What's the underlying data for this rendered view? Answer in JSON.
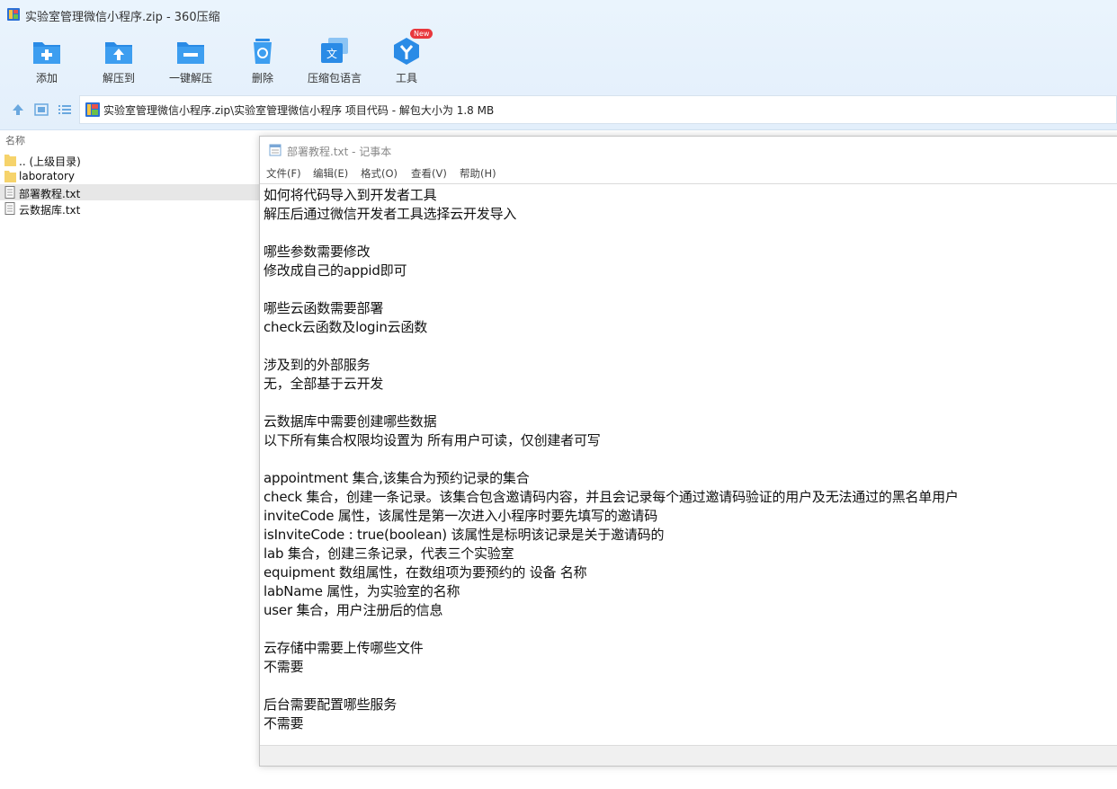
{
  "window": {
    "title": "实验室管理微信小程序.zip - 360压缩"
  },
  "toolbar": {
    "items": [
      {
        "label": "添加",
        "icon": "add-icon"
      },
      {
        "label": "解压到",
        "icon": "extract-to-icon"
      },
      {
        "label": "一键解压",
        "icon": "one-click-extract-icon"
      },
      {
        "label": "删除",
        "icon": "delete-icon"
      },
      {
        "label": "压缩包语言",
        "icon": "language-icon"
      },
      {
        "label": "工具",
        "icon": "tools-icon",
        "badge": "New"
      }
    ]
  },
  "address": {
    "path": "实验室管理微信小程序.zip\\实验室管理微信小程序 项目代码 - 解包大小为 1.8 MB"
  },
  "filelist": {
    "header": "名称",
    "items": [
      {
        "name": ".. (上级目录)",
        "type": "folder"
      },
      {
        "name": "laboratory",
        "type": "folder"
      },
      {
        "name": "部署教程.txt",
        "type": "txt",
        "selected": true
      },
      {
        "name": "云数据库.txt",
        "type": "txt"
      }
    ]
  },
  "notepad": {
    "title": "部署教程.txt - 记事本",
    "menu": [
      "文件(F)",
      "编辑(E)",
      "格式(O)",
      "查看(V)",
      "帮助(H)"
    ],
    "lines": [
      "如何将代码导入到开发者工具",
      "解压后通过微信开发者工具选择云开发导入",
      "",
      "哪些参数需要修改",
      "修改成自己的appid即可",
      "",
      "哪些云函数需要部署",
      "check云函数及login云函数",
      "",
      "涉及到的外部服务",
      "无，全部基于云开发",
      "",
      "云数据库中需要创建哪些数据",
      "以下所有集合权限均设置为 所有用户可读，仅创建者可写",
      "",
      "appointment 集合,该集合为预约记录的集合",
      "check 集合，创建一条记录。该集合包含邀请码内容，并且会记录每个通过邀请码验证的用户及无法通过的黑名单用户",
      "inviteCode 属性，该属性是第一次进入小程序时要先填写的邀请码",
      "isInviteCode : true(boolean) 该属性是标明该记录是关于邀请码的",
      "lab 集合，创建三条记录，代表三个实验室",
      "equipment 数组属性，在数组项为要预约的 设备 名称",
      "labName 属性，为实验室的名称",
      "user 集合，用户注册后的信息",
      "",
      "云存储中需要上传哪些文件",
      "不需要",
      "",
      "后台需要配置哪些服务",
      "不需要"
    ]
  }
}
